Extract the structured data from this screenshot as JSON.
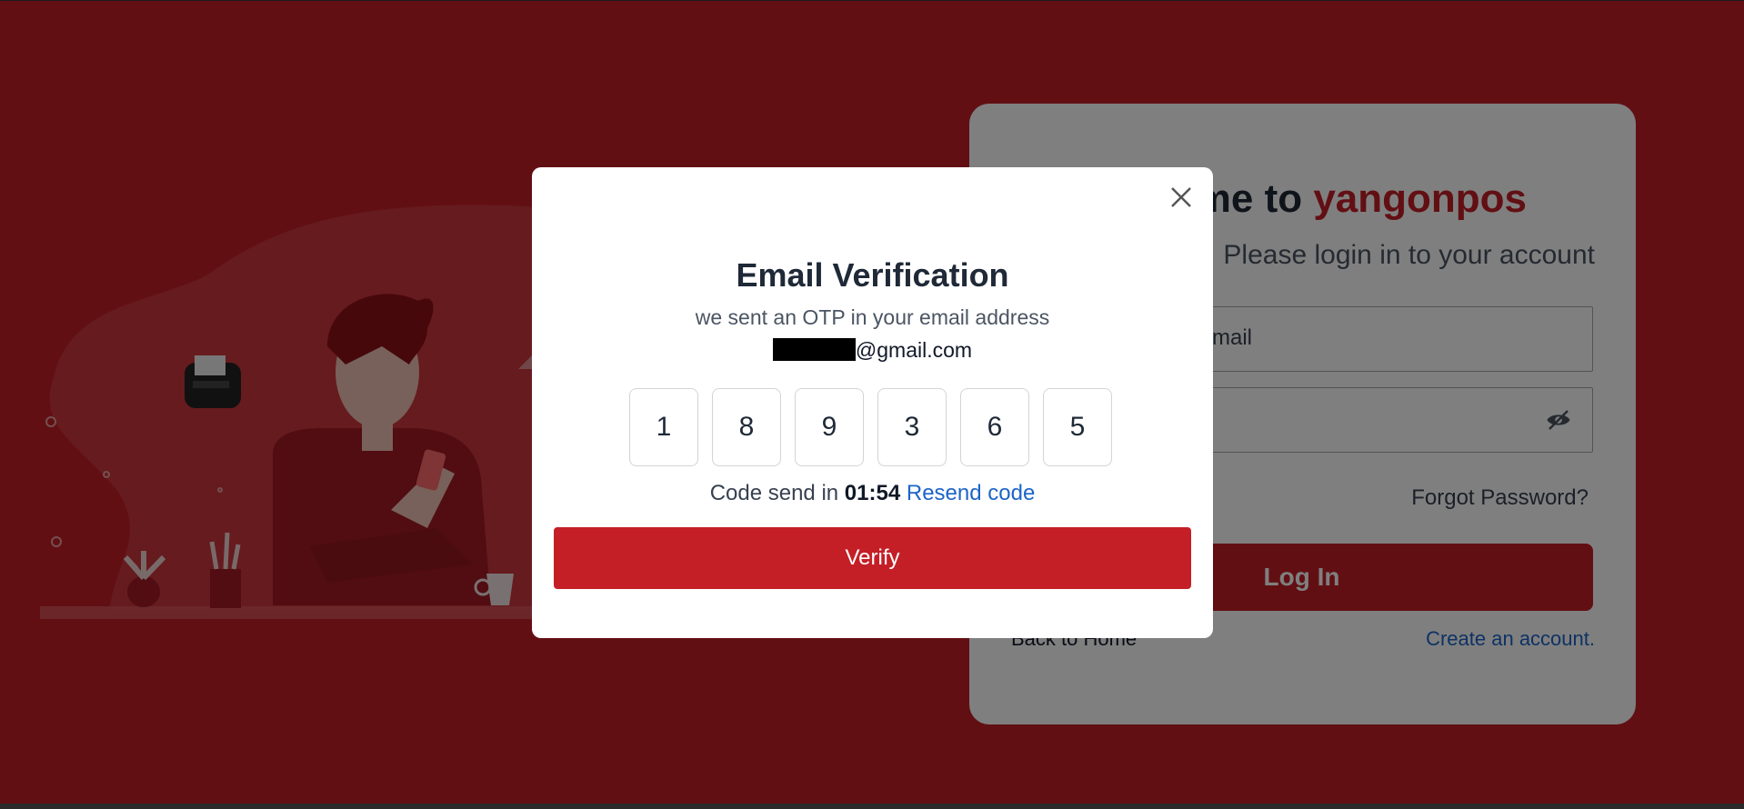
{
  "login_card": {
    "welcome_prefix": "Welcome to",
    "brand": "yangonpos",
    "subtitle": "Please login in to your account",
    "email_placeholder": "Email",
    "forgot_password": "Forgot Password?",
    "login_button": "Log In",
    "back_to_home": "Back to Home",
    "create_account": "Create an account."
  },
  "modal": {
    "title": "Email Verification",
    "sent_text": "we sent an OTP in your email address",
    "email_suffix": "@gmail.com",
    "otp_digits": [
      "1",
      "8",
      "9",
      "3",
      "6",
      "5"
    ],
    "resend_prefix": "Code send in",
    "timer": "01:54",
    "resend_link": "Resend code",
    "verify_button": "Verify"
  },
  "colors": {
    "brand_red": "#c41f27",
    "link_blue": "#1d64c8"
  },
  "icons": [
    "close-icon",
    "eye-off-icon",
    "printer-icon",
    "plant-icon",
    "pencil-cup-icon",
    "coffee-cup-icon"
  ]
}
